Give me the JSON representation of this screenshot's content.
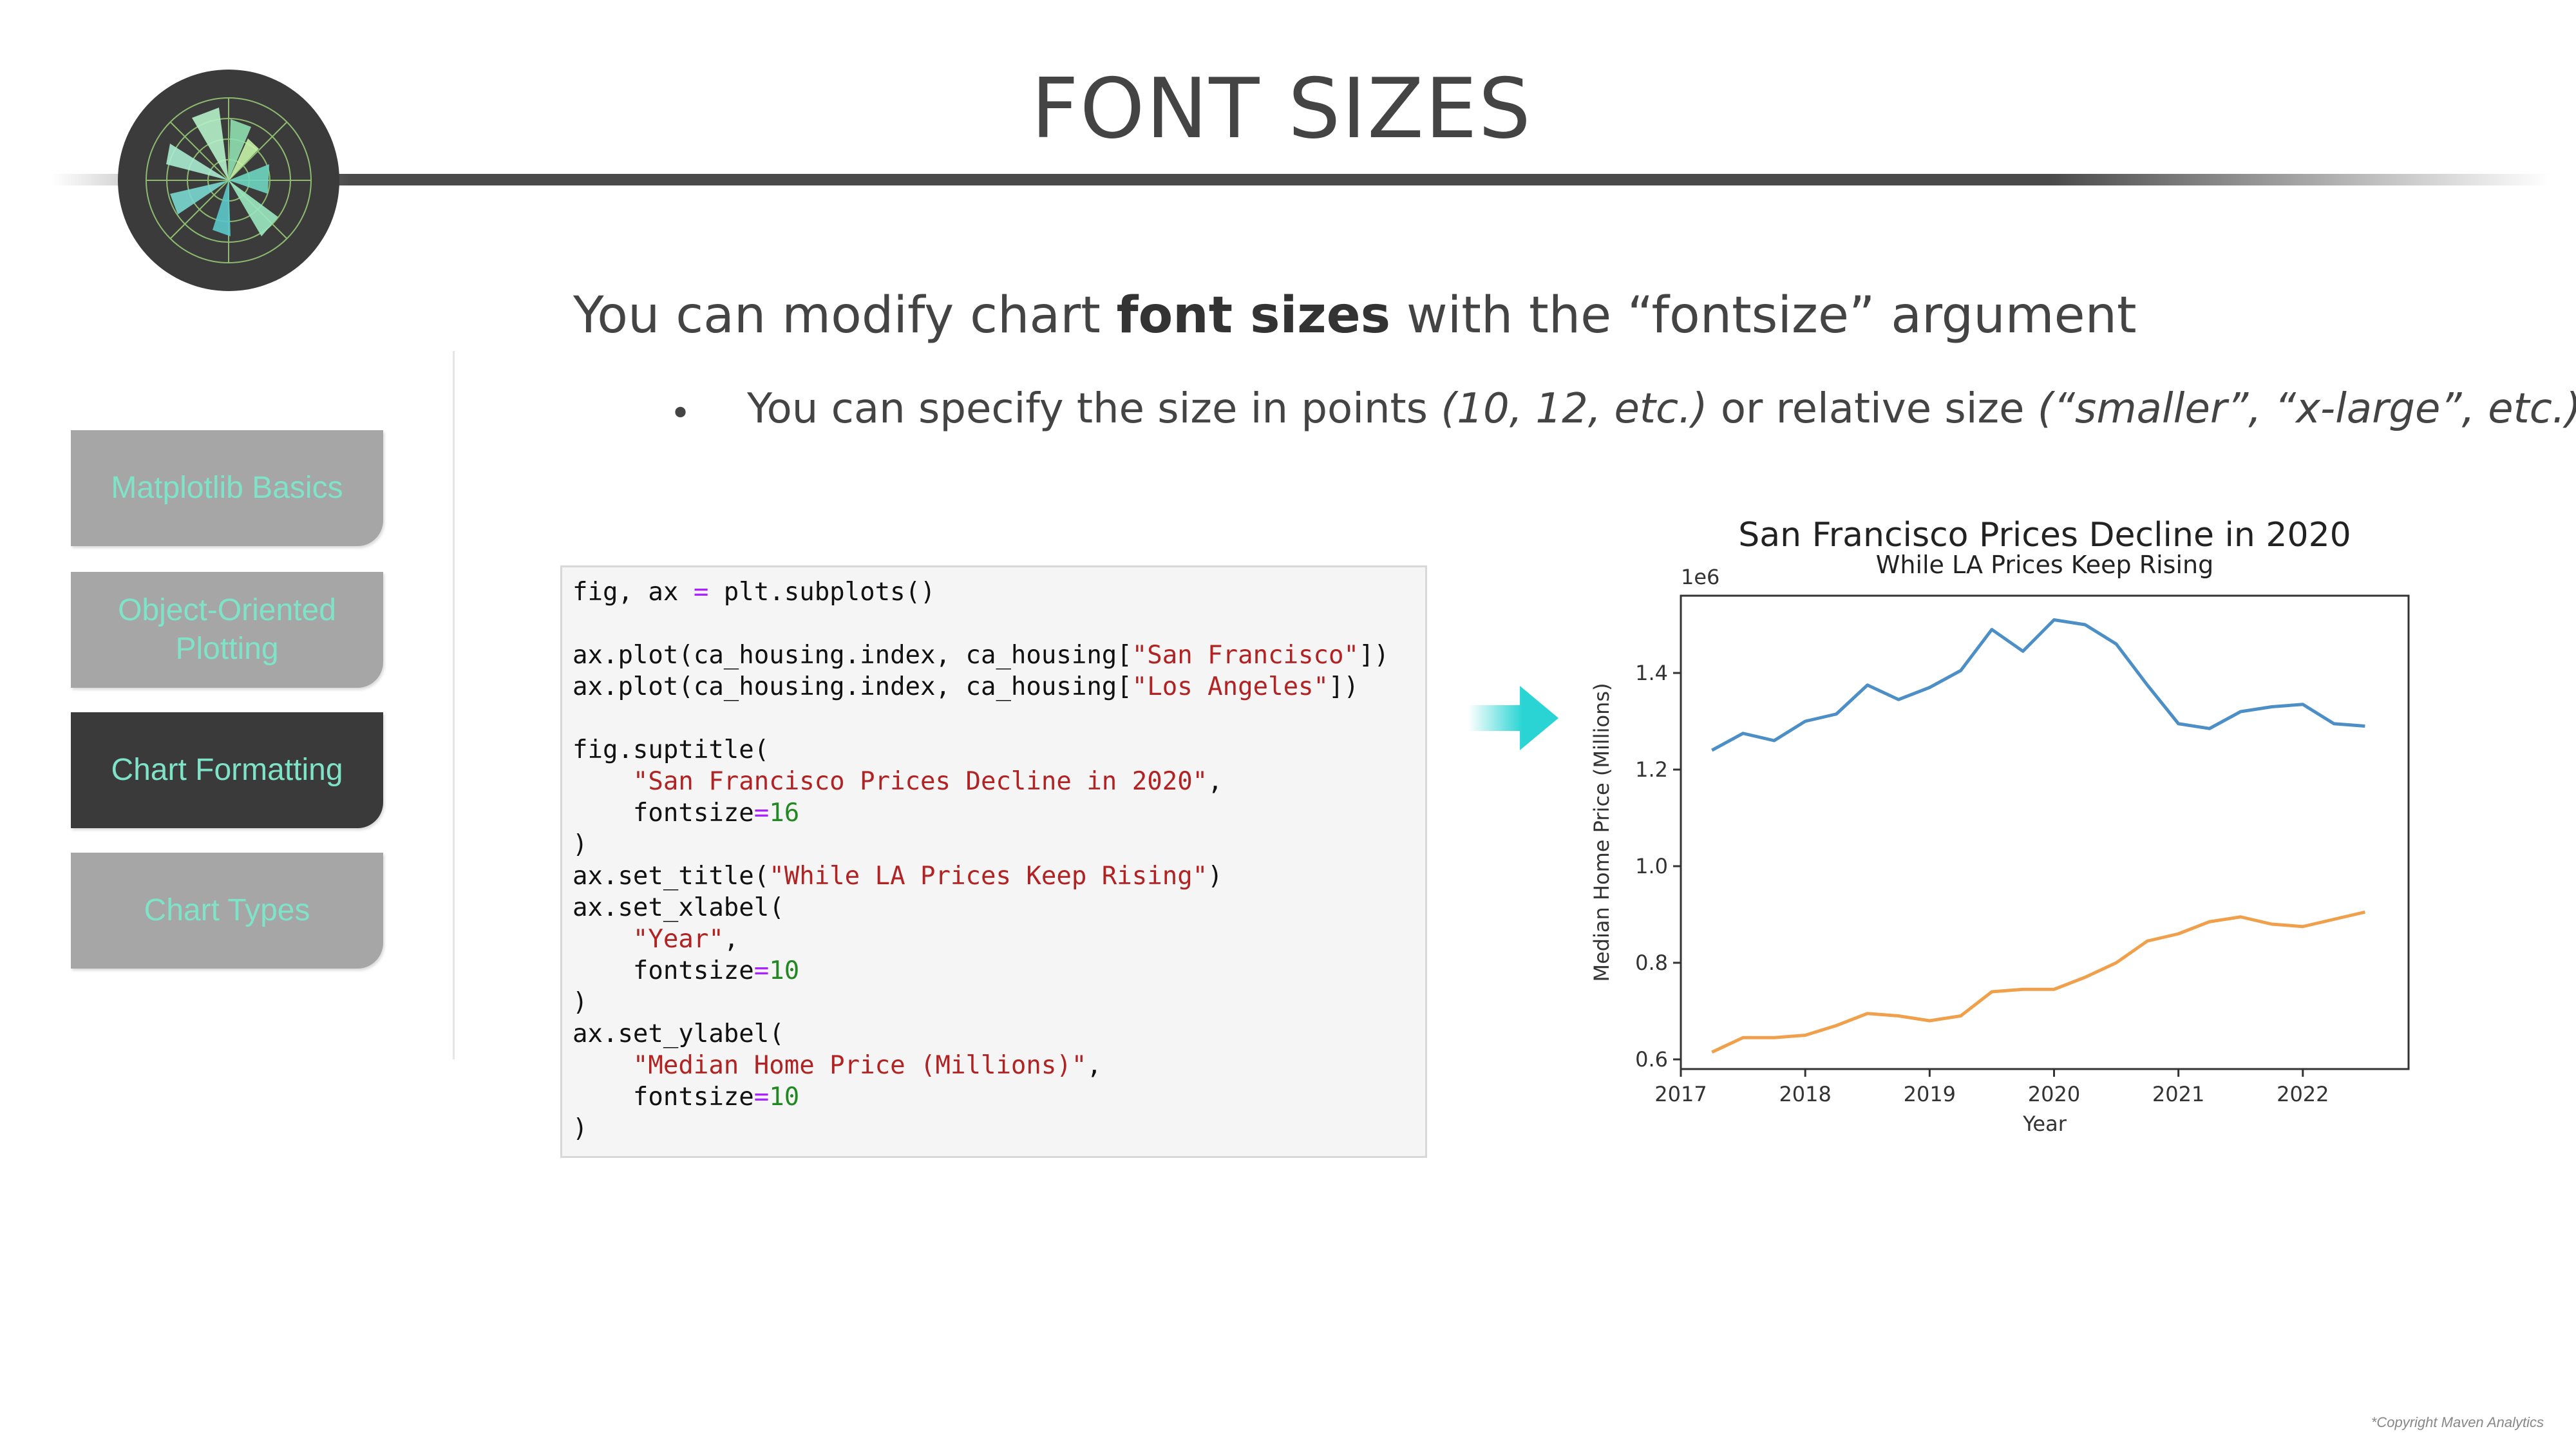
{
  "page": {
    "title": "FONT SIZES",
    "copyright": "*Copyright Maven Analytics"
  },
  "nav": {
    "items": [
      {
        "label": "Matplotlib Basics",
        "active": false
      },
      {
        "label": "Object-Oriented Plotting",
        "active": false
      },
      {
        "label": "Chart Formatting",
        "active": true
      },
      {
        "label": "Chart Types",
        "active": false
      }
    ]
  },
  "content": {
    "headline_pre": "You can modify chart ",
    "headline_bold": "font sizes",
    "headline_post": " with the “fontsize” argument",
    "bullet_pre": "You can specify the size in points ",
    "bullet_italic1": "(10, 12, etc.)",
    "bullet_mid": " or relative size ",
    "bullet_italic2": "(“smaller”, “x-large”, etc.)"
  },
  "code": {
    "lines": [
      [
        {
          "t": "fig, ax "
        },
        {
          "t": "=",
          "c": "op"
        },
        {
          "t": " plt.subplots()"
        }
      ],
      [],
      [
        {
          "t": "ax.plot(ca_housing.index, ca_housing["
        },
        {
          "t": "\"San Francisco\"",
          "c": "s"
        },
        {
          "t": "])"
        }
      ],
      [
        {
          "t": "ax.plot(ca_housing.index, ca_housing["
        },
        {
          "t": "\"Los Angeles\"",
          "c": "s"
        },
        {
          "t": "])"
        }
      ],
      [],
      [
        {
          "t": "fig.suptitle("
        }
      ],
      [
        {
          "t": "    "
        },
        {
          "t": "\"San Francisco Prices Decline in 2020\"",
          "c": "s"
        },
        {
          "t": ","
        }
      ],
      [
        {
          "t": "    fontsize"
        },
        {
          "t": "=",
          "c": "op"
        },
        {
          "t": "16",
          "c": "n"
        }
      ],
      [
        {
          "t": ")"
        }
      ],
      [
        {
          "t": "ax.set_title("
        },
        {
          "t": "\"While LA Prices Keep Rising\"",
          "c": "s"
        },
        {
          "t": ")"
        }
      ],
      [
        {
          "t": "ax.set_xlabel("
        }
      ],
      [
        {
          "t": "    "
        },
        {
          "t": "\"Year\"",
          "c": "s"
        },
        {
          "t": ","
        }
      ],
      [
        {
          "t": "    fontsize"
        },
        {
          "t": "=",
          "c": "op"
        },
        {
          "t": "10",
          "c": "n"
        }
      ],
      [
        {
          "t": ")"
        }
      ],
      [
        {
          "t": "ax.set_ylabel("
        }
      ],
      [
        {
          "t": "    "
        },
        {
          "t": "\"Median Home Price (Millions)\"",
          "c": "s"
        },
        {
          "t": ","
        }
      ],
      [
        {
          "t": "    fontsize"
        },
        {
          "t": "=",
          "c": "op"
        },
        {
          "t": "10",
          "c": "n"
        }
      ],
      [
        {
          "t": ")"
        }
      ]
    ]
  },
  "colors": {
    "accent": "#7fe3c8",
    "arrow": "#2ad4d4",
    "series_sf": "#4c8fc6",
    "series_la": "#f0a04b",
    "nav_inactive": "#a6a6a6",
    "nav_active": "#3a3a3a"
  },
  "chart_data": {
    "type": "line",
    "title": "San Francisco Prices Decline in 2020",
    "subtitle": "While LA Prices Keep Rising",
    "xlabel": "Year",
    "ylabel": "Median Home Price (Millions)",
    "offset_label": "1e6",
    "xlim": [
      2017.0,
      2022.85
    ],
    "ylim": [
      0.58,
      1.56
    ],
    "x_ticks": [
      2017,
      2018,
      2019,
      2020,
      2021,
      2022
    ],
    "y_ticks": [
      0.6,
      0.8,
      1.0,
      1.2,
      1.4
    ],
    "y_tick_labels": [
      "0.6",
      "0.8",
      "1.0",
      "1.2",
      "1.4"
    ],
    "grid": false,
    "legend": "none",
    "x": [
      2017.25,
      2017.5,
      2017.75,
      2018.0,
      2018.25,
      2018.5,
      2018.75,
      2019.0,
      2019.25,
      2019.5,
      2019.75,
      2020.0,
      2020.25,
      2020.5,
      2020.75,
      2021.0,
      2021.25,
      2021.5,
      2021.75,
      2022.0,
      2022.25,
      2022.5
    ],
    "series": [
      {
        "values": [
          1.24,
          1.275,
          1.26,
          1.3,
          1.315,
          1.375,
          1.345,
          1.37,
          1.405,
          1.49,
          1.445,
          1.51,
          1.5,
          1.46,
          1.375,
          1.295,
          1.285,
          1.32,
          1.33,
          1.335,
          1.295,
          1.29
        ]
      },
      {
        "values": [
          0.615,
          0.645,
          0.645,
          0.65,
          0.67,
          0.695,
          0.69,
          0.68,
          0.69,
          0.74,
          0.745,
          0.745,
          0.77,
          0.8,
          0.845,
          0.86,
          0.885,
          0.895,
          0.88,
          0.875,
          0.89,
          0.905
        ]
      }
    ]
  }
}
